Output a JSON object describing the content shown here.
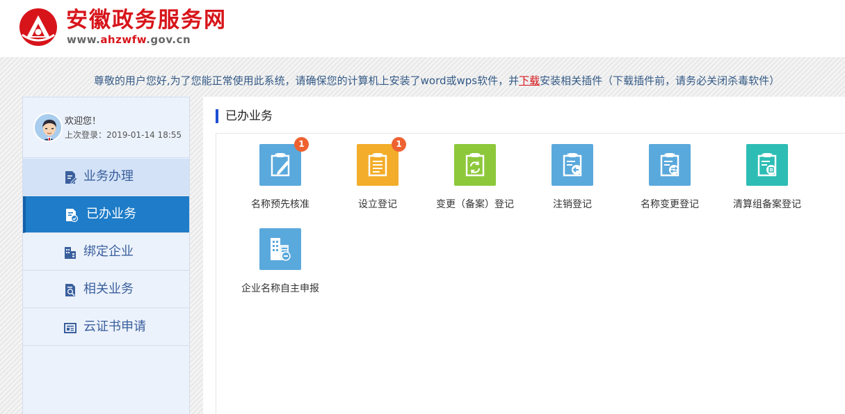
{
  "header": {
    "site_title": "安徽政务服务网",
    "url_prefix": "www.",
    "url_brand": "ahzwfw",
    "url_suffix": ".gov.cn",
    "brand_color": "#d7141a"
  },
  "notice": {
    "before_link": "尊敬的用户您好,为了您能正常使用此系统，请确保您的计算机上安装了word或wps软件，并",
    "link_text": "下载",
    "after_link": "安装相关插件（下载插件前，请务必关闭杀毒软件）"
  },
  "user": {
    "welcome": "欢迎您！",
    "last_login": "上次登录：2019-01-14 18:55"
  },
  "sidebar": {
    "items": [
      {
        "label": "业务办理",
        "icon": "edit-doc-icon"
      },
      {
        "label": "已办业务",
        "icon": "done-doc-icon",
        "active": true
      },
      {
        "label": "绑定企业",
        "icon": "building-icon"
      },
      {
        "label": "相关业务",
        "icon": "search-doc-icon"
      },
      {
        "label": "云证书申请",
        "icon": "certificate-icon"
      }
    ],
    "active_color": "#1e7cc8"
  },
  "main": {
    "title": "已办业务",
    "tiles": [
      {
        "label": "名称预先核准",
        "badge": "1",
        "color": "#5aa9dc",
        "icon": "clipboard-pen-icon"
      },
      {
        "label": "设立登记",
        "badge": "1",
        "color": "#f3ad2a",
        "icon": "clipboard-list-icon"
      },
      {
        "label": "变更（备案）登记",
        "color": "#8dc83b",
        "icon": "clipboard-refresh-icon"
      },
      {
        "label": "注销登记",
        "color": "#5aa9dc",
        "icon": "clipboard-return-icon"
      },
      {
        "label": "名称变更登记",
        "color": "#5aa9dc",
        "icon": "clipboard-swap-icon"
      },
      {
        "label": "清算组备案登记",
        "color": "#2dbdb5",
        "icon": "clipboard-file-icon"
      },
      {
        "label": "企业名称自主申报",
        "color": "#5aa9dc",
        "icon": "building-name-icon"
      }
    ]
  }
}
